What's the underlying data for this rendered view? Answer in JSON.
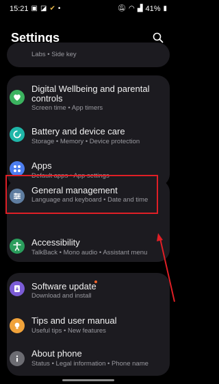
{
  "status_bar": {
    "time": "15:21",
    "battery": "41%"
  },
  "header": {
    "title": "Settings"
  },
  "partial_item": {
    "subtitle": "Labs  •  Side key"
  },
  "items": [
    {
      "title_line1": "Digital Wellbeing and parental",
      "title_line2": "controls",
      "subtitle": "Screen time  •  App timers",
      "icon": "digital-wellbeing-icon",
      "color": "#3bb35f"
    },
    {
      "title": "Battery and device care",
      "subtitle": "Storage  •  Memory  •  Device protection",
      "icon": "device-care-icon",
      "color": "#1fb6a8"
    },
    {
      "title": "Apps",
      "subtitle": "Default apps  •  App settings",
      "icon": "apps-icon",
      "color": "#4c7ef0"
    },
    {
      "title": "General management",
      "subtitle": "Language and keyboard  •  Date and time",
      "icon": "sliders-icon",
      "color": "#5f7da0"
    },
    {
      "title": "Accessibility",
      "subtitle": "TalkBack  •  Mono audio  •  Assistant menu",
      "icon": "accessibility-icon",
      "color": "#2a9d5c"
    },
    {
      "title": "Software update",
      "subtitle": "Download and install",
      "icon": "software-update-icon",
      "color": "#7b5cd6"
    },
    {
      "title": "Tips and user manual",
      "subtitle": "Useful tips  •  New features",
      "icon": "tips-icon",
      "color": "#f0a23a"
    },
    {
      "title": "About phone",
      "subtitle": "Status  •  Legal information  •  Phone name",
      "icon": "about-phone-icon",
      "color": "#6c6c72"
    }
  ],
  "colors": {
    "highlight": "#e01f26",
    "update_badge": "#f0622a"
  }
}
